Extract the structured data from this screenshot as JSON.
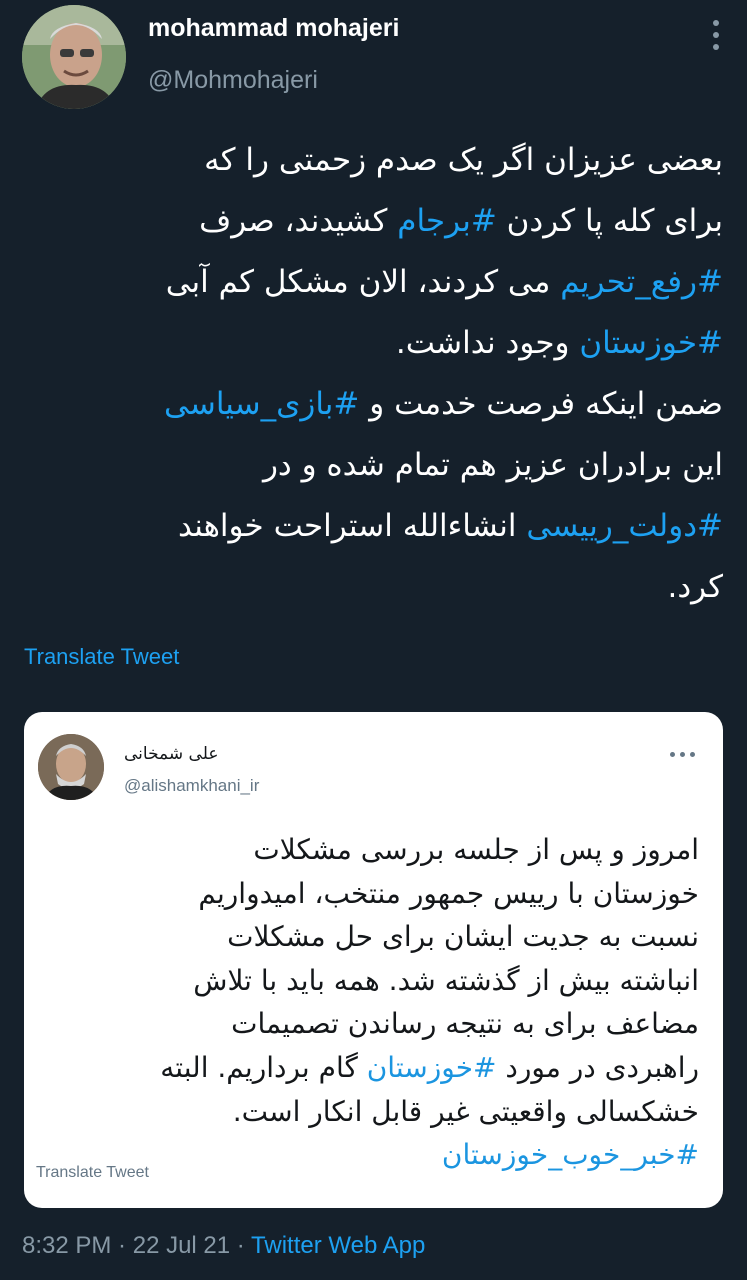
{
  "author": {
    "name": "mohammad mohajeri",
    "handle": "@Mohmohajeri"
  },
  "tweet": {
    "lines": [
      [
        {
          "t": "بعضی عزیزان اگر یک صدم زحمتی را که"
        }
      ],
      [
        {
          "t": "برای کله پا کردن "
        },
        {
          "t": "#برجام",
          "tag": true
        },
        {
          "t": " کشیدند، صرف"
        }
      ],
      [
        {
          "t": "#رفع_تحریم",
          "tag": true
        },
        {
          "t": " می کردند، الان مشکل کم آبی"
        }
      ],
      [
        {
          "t": "#خوزستان",
          "tag": true
        },
        {
          "t": " وجود نداشت."
        }
      ],
      [
        {
          "t": "ضمن اینکه فرصت خدمت و "
        },
        {
          "t": "#بازی_سیاسی",
          "tag": true
        }
      ],
      [
        {
          "t": "این برادران عزیز هم تمام شده و در"
        }
      ],
      [
        {
          "t": "#دولت_رییسی",
          "tag": true
        },
        {
          "t": " انشاءالله استراحت خواهند"
        }
      ],
      [
        {
          "t": "کرد."
        }
      ]
    ],
    "translate_label": "Translate Tweet"
  },
  "quoted": {
    "name": "علی شمخانی",
    "handle": "@alishamkhani_ir",
    "lines": [
      [
        {
          "t": "امروز و پس از جلسه بررسی مشکلات"
        }
      ],
      [
        {
          "t": "خوزستان با رییس جمهور منتخب، امیدواریم"
        }
      ],
      [
        {
          "t": "نسبت به جدیت ایشان برای حل مشکلات"
        }
      ],
      [
        {
          "t": "انباشته بیش از گذشته شد. همه باید با تلاش"
        }
      ],
      [
        {
          "t": "مضاعف برای به نتیجه رساندن تصمیمات"
        }
      ],
      [
        {
          "t": "راهبردی در مورد "
        },
        {
          "t": "#خوزستان",
          "tag": true
        },
        {
          "t": " گام برداریم. البته"
        }
      ],
      [
        {
          "t": "خشکسالی واقعیتی غیر قابل انکار است."
        }
      ],
      [
        {
          "t": "#خبر_خوب_خوزستان",
          "tag": true
        }
      ]
    ],
    "translate_label": "Translate Tweet"
  },
  "meta": {
    "time": "8:32 PM",
    "sep1": " · ",
    "date": "22 Jul 21",
    "sep2": " · ",
    "source": "Twitter Web App"
  },
  "colors": {
    "background": "#15202b",
    "accent": "#1da1f2",
    "muted": "#8899a6"
  },
  "icons": [
    "more-options-icon",
    "card-more-options-icon"
  ]
}
